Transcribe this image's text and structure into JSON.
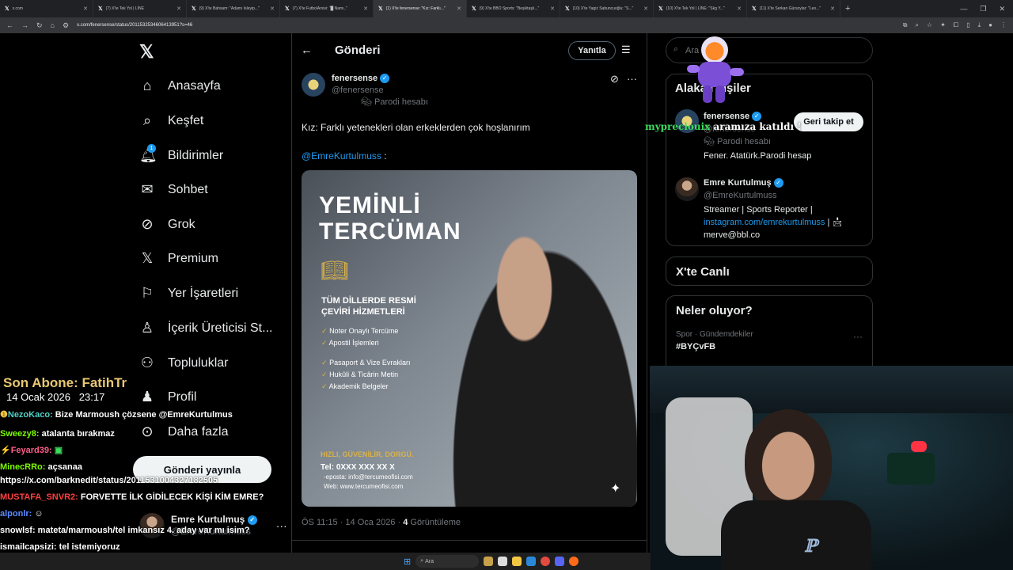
{
  "browser": {
    "tabs": [
      {
        "label": "x.com"
      },
      {
        "label": "(7) X'te Tek Yol | LİNE"
      },
      {
        "label": "(9) X'te Bahsam: \"Adamı Isleyip...\""
      },
      {
        "label": "(7) X'te FutbolArsivi: \"█ Namı..\""
      },
      {
        "label": "(1) X'te fenersense: \"Kız: Farklı...\"",
        "active": true
      },
      {
        "label": "(9) X'te BBO Sports: \"Beşiktaşlı...\""
      },
      {
        "label": "(10) X'te Yagiz Sabuncuoğlu: \"S...\""
      },
      {
        "label": "(10) X'te Tek Yol | LİNE: \"Skg Y...\""
      },
      {
        "label": "(11) X'te Serkan Gürsoylar: \"Leo...\""
      }
    ],
    "url": "x.com/fenersense/status/2011532534606413951?s=46"
  },
  "nav": {
    "items": [
      {
        "label": "Anasayfa",
        "icon": "home-icon"
      },
      {
        "label": "Keşfet",
        "icon": "search-icon"
      },
      {
        "label": "Bildirimler",
        "icon": "bell-icon",
        "badge": "1"
      },
      {
        "label": "Sohbet",
        "icon": "mail-icon"
      },
      {
        "label": "Grok",
        "icon": "grok-icon"
      },
      {
        "label": "Premium",
        "icon": "x-icon"
      },
      {
        "label": "Yer İşaretleri",
        "icon": "bookmark-icon"
      },
      {
        "label": "İçerik Üreticisi St...",
        "icon": "creator-icon"
      },
      {
        "label": "Topluluklar",
        "icon": "communities-icon"
      },
      {
        "label": "Profil",
        "icon": "profile-icon"
      },
      {
        "label": "Daha fazla",
        "icon": "more-icon"
      }
    ],
    "post_button": "Gönderi yayınla",
    "account": {
      "name": "Emre Kurtulmuş",
      "handle": "@EmreKurtulmuss"
    }
  },
  "header": {
    "title": "Gönderi",
    "reply_button": "Yanıtla"
  },
  "post": {
    "author": "fenersense",
    "handle": "@fenersense",
    "tag": "Parodi hesabı",
    "text": "Kız: Farklı yetenekleri olan erkeklerden çok hoşlanırım",
    "mention": "@EmreKurtulmuss",
    "mention_suffix": " :",
    "image": {
      "title1": "YEMİNLİ",
      "title2": "TERCÜMAN",
      "subtitle1": "TÜM DİLLERDE RESMİ",
      "subtitle2": "ÇEVİRİ HİZMETLERİ",
      "list1": [
        "Noter Onaylı Tercüme",
        "Apostil İşlemleri"
      ],
      "list2": [
        "Pasaport & Vize Evrakları",
        "Hukûli & Ticârin Metin",
        "Akademik Belgeler"
      ],
      "footer": "HIZLI, GÜVENİLİR, DORGÜ.",
      "tel": "Tel: 0XXX XXX XX X",
      "email": "-eposta: info@tercumeofisi.com",
      "web": "Web: www.tercumeofisi.com"
    },
    "time": "ÖS 11:15 · 14 Oca 2026 · ",
    "views_count": "4",
    "views_label": " Görüntüleme"
  },
  "sidebar": {
    "search_placeholder": "Ara",
    "people_title": "Alakalı kişiler",
    "people": [
      {
        "name": "fenersense",
        "handle": "@fenersense",
        "tag": "Parodi hesabı",
        "bio": "Fener. Atatürk.Parodi hesap",
        "button": "Geri takip et"
      },
      {
        "name": "Emre Kurtulmuş",
        "handle": "@EmreKurtulmuss",
        "bio1": "Streamer | Sports Reporter |",
        "bio_link": "instagram.com/emrekurtulmuss",
        "bio2": "merve@bbl.co"
      }
    ],
    "live_title": "X'te Canlı",
    "trends_title": "Neler oluyor?",
    "trend_meta": "Spor · Gündemdekiler",
    "trend": "#BYÇvFB"
  },
  "overlay": {
    "sub_label": "Son Abone: FatihTr",
    "sub_date": "14 Ocak 2026",
    "sub_time": "23:17",
    "alert_user": "mypreciouix",
    "alert_text": " aramıza katıldı !",
    "chat": [
      {
        "user": "NezoKaco:",
        "text": " Bize Marmoush çözsene @EmreKurtulmus",
        "color": "#4fd1c5"
      },
      {
        "user": "Sweezy8:",
        "text": " atalanta bırakmaz",
        "color": "#7cfc00"
      },
      {
        "user": "Feyard39:",
        "text": " ",
        "color": "#ff5c8a"
      },
      {
        "user": "MinecRRo:",
        "text": " açsanaa",
        "color": "#7cfc00"
      },
      {
        "user": "",
        "text": "https://x.com/barknedit/status/2011531004327182505",
        "color": "#fff"
      },
      {
        "user": "MUSTAFA_SNVR2:",
        "text": " FORVETTE İLK GİDİLECEK KİŞİ KİM EMRE?",
        "color": "#ff4040"
      },
      {
        "user": "alponlr:",
        "text": " ",
        "color": "#5b8cff"
      },
      {
        "user": "snowlsf:",
        "text": " mateta/marmoush/tel imkansız 4. aday var mı isim?",
        "color": "#fff"
      },
      {
        "user": "ismailcapsizi:",
        "text": " tel istemiyoruz",
        "color": "#fff"
      }
    ]
  },
  "taskbar": {
    "search": "Ara"
  }
}
